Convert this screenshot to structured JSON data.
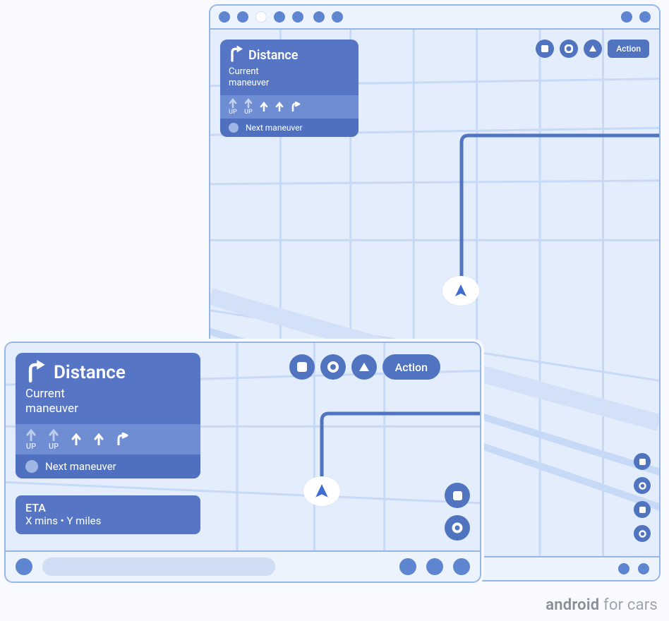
{
  "action_button_label": "Action",
  "nav_card": {
    "distance_label": "Distance",
    "current_maneuver": "Current\nmaneuver",
    "lanes": [
      {
        "kind": "up",
        "label": "UP"
      },
      {
        "kind": "up",
        "label": "UP"
      },
      {
        "kind": "up",
        "label": ""
      },
      {
        "kind": "up",
        "label": ""
      },
      {
        "kind": "right",
        "label": ""
      }
    ],
    "next_maneuver": "Next maneuver"
  },
  "eta": {
    "title": "ETA",
    "subtitle": "X mins • Y miles"
  },
  "watermark_bold": "android",
  "watermark_light": " for cars"
}
